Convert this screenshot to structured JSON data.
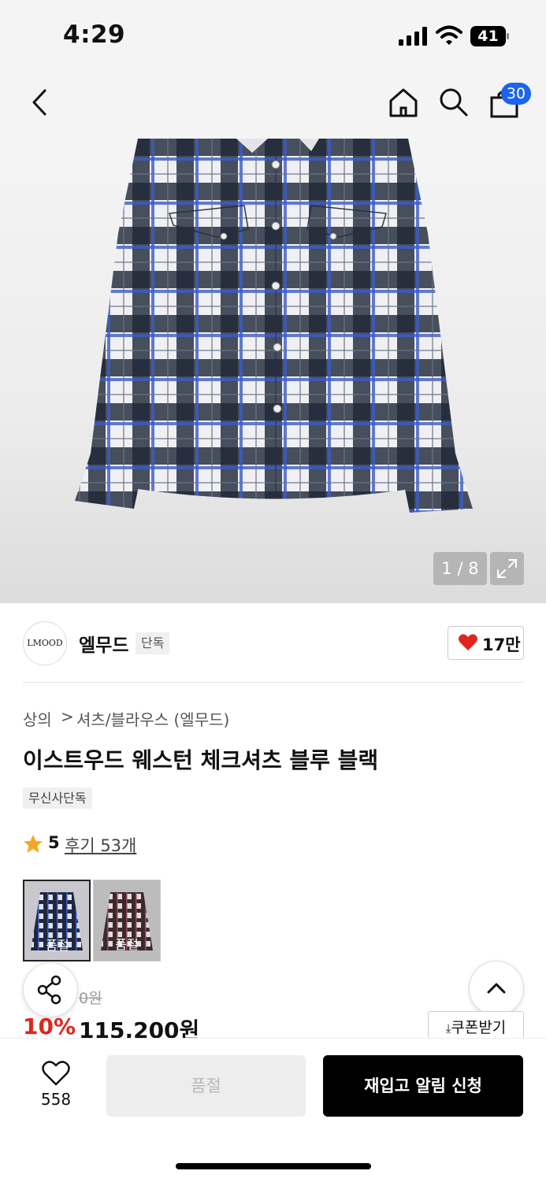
{
  "status_bar": {
    "time": "4:29",
    "battery": "41"
  },
  "header": {
    "cart_count": "30"
  },
  "gallery": {
    "counter": "1 / 8"
  },
  "brand": {
    "logo_text": "LMOOD",
    "name": "엘무드",
    "tag": "단독",
    "likes": "17만"
  },
  "breadcrumb": {
    "level1": "상의",
    "separator": ">",
    "level2": "셔츠/블라우스 (엘무드)"
  },
  "product": {
    "title": "이스트우드 웨스턴 체크셔츠 블루 블랙",
    "exclusive_tag": "무신사단독",
    "rating": "5",
    "review_link": "후기 53개"
  },
  "colors": [
    {
      "name": "blue-black",
      "status": "품절",
      "color": "#2b3a5e"
    },
    {
      "name": "red-black",
      "status": "품절",
      "color": "#5a3a40"
    }
  ],
  "pricing": {
    "original_partial": "0원",
    "discount": "10%",
    "price": "115,200원",
    "coupon_label": "쿠폰받기"
  },
  "bottom_bar": {
    "wish_count": "558",
    "soldout_label": "품절",
    "restock_label": "재입고 알림 신청"
  },
  "colors_theme": {
    "accent_blue": "#1c63f2",
    "discount_red": "#e0261c",
    "star": "#f5a623"
  }
}
